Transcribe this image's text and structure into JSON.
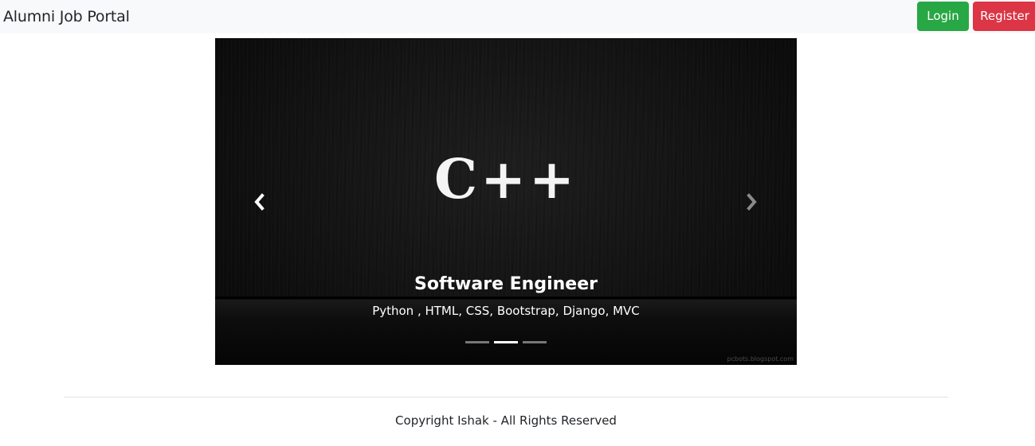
{
  "navbar": {
    "brand": "Alumni Job Portal",
    "login_label": "Login",
    "register_label": "Register"
  },
  "carousel": {
    "slide_image_text": "C++",
    "caption_title": "Software Engineer",
    "caption_text": "Python , HTML, CSS, Bootstrap, Django, MVC",
    "watermark": "pcbots.blogspot.com",
    "indicator_count": 3,
    "active_indicator": 2,
    "prev_icon": "chevron-left-icon",
    "next_icon": "chevron-right-icon"
  },
  "footer": {
    "copyright": "Copyright Ishak - All Rights Reserved"
  },
  "colors": {
    "login": "#28a745",
    "register": "#dc3545",
    "navbar_bg": "#f8f9fa"
  }
}
